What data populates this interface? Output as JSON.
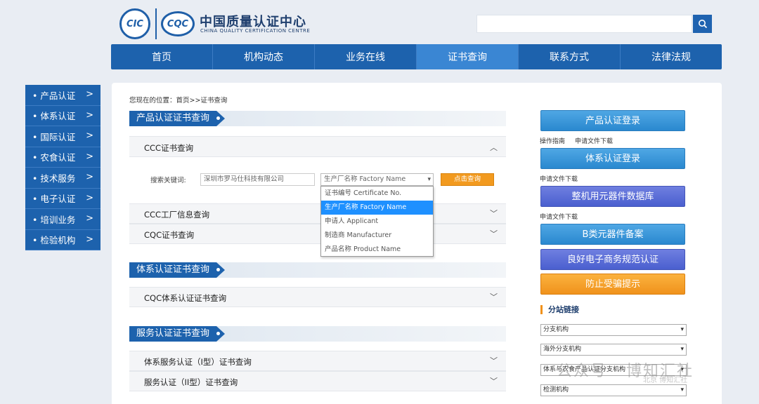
{
  "header": {
    "logo_cic": "CIC",
    "logo_cqc": "CQC",
    "brand_cn": "中国质量认证中心",
    "brand_en": "CHINA QUALITY CERTIFICATION CENTRE"
  },
  "nav": [
    "首页",
    "机构动态",
    "业务在线",
    "证书查询",
    "联系方式",
    "法律法规"
  ],
  "sidebar": [
    "• 产品认证",
    "• 体系认证",
    "• 国际认证",
    "• 农食认证",
    "• 技术服务",
    "• 电子认证",
    "• 培训业务",
    "• 检验机构"
  ],
  "breadcrumb": "您现在的位置：首页>>证书查询",
  "sections": {
    "product": "产品认证证书查询",
    "system": "体系认证证书查询",
    "service": "服务认证证书查询"
  },
  "accordions": {
    "ccc": "CCC证书查询",
    "ccc_factory": "CCC工厂信息查询",
    "cqc": "CQC证书查询",
    "cqc_system": "CQC体系认证证书查询",
    "svc_type1": "体系服务认证（I型）证书查询",
    "svc_type2": "服务认证（II型）证书查询"
  },
  "search": {
    "keyword_label": "搜索关键词:",
    "keyword_value": "深圳市罗马仕科技有限公司",
    "selected": "生产厂名称 Factory Name",
    "button": "点击查询",
    "options": [
      "证书编号 Certificate No.",
      "生产厂名称 Factory Name",
      "申请人 Applicant",
      "制造商 Manufacturer",
      "产品名称 Product Name"
    ]
  },
  "right": {
    "btn_product": "产品认证登录",
    "link_guide": "操作指南",
    "link_apply_dl1": "申请文件下载",
    "btn_system": "体系认证登录",
    "link_apply_dl2": "申请文件下载",
    "btn_components": "整机用元器件数据库",
    "link_apply_dl3": "申请文件下载",
    "btn_classb": "B类元器件备案",
    "btn_ecommerce": "良好电子商务规范认证",
    "btn_fraud": "防止受骗提示",
    "branch_title": "分站链接",
    "selects": [
      "分支机构",
      "海外分支机构",
      "体系与农食产品认证分支机构",
      "检测机构"
    ]
  },
  "watermark": {
    "text": "公众号 · 博知汇社",
    "sub": "北京 博知汇社"
  }
}
